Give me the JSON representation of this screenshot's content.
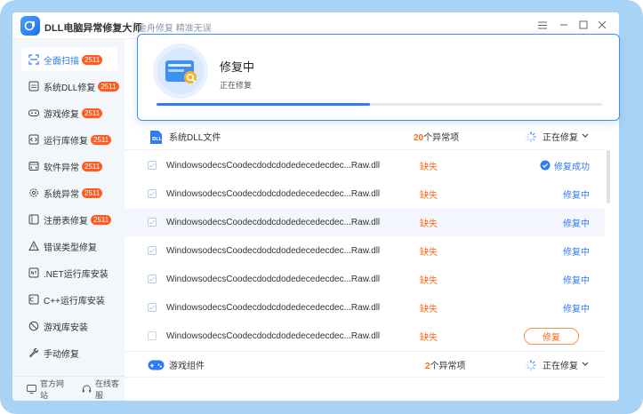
{
  "app": {
    "title": "DLL电脑异常修复大师",
    "slogan": "金舟修复 精准无误"
  },
  "window_controls": [
    "menu-icon",
    "minimize-icon",
    "maximize-icon",
    "close-icon"
  ],
  "sidebar": {
    "items": [
      {
        "label": "全面扫描",
        "badge": "2511",
        "icon": "scan-icon",
        "active": true
      },
      {
        "label": "系统DLL修复",
        "badge": "2511",
        "icon": "dll-icon"
      },
      {
        "label": "游戏修复",
        "badge": "2511",
        "icon": "gamepad-icon"
      },
      {
        "label": "运行库修复",
        "badge": "2511",
        "icon": "runtime-icon"
      },
      {
        "label": "软件异常",
        "badge": "2511",
        "icon": "software-icon"
      },
      {
        "label": "系统异常",
        "badge": "2511",
        "icon": "gear-icon"
      },
      {
        "label": "注册表修复",
        "badge": "2511",
        "icon": "registry-icon"
      },
      {
        "label": "错误类型修复",
        "badge": "",
        "icon": "warning-icon"
      },
      {
        "label": ".NET运行库安装",
        "badge": "",
        "icon": "net-icon"
      },
      {
        "label": "C++运行库安装",
        "badge": "",
        "icon": "cpp-icon"
      },
      {
        "label": "游戏库安装",
        "badge": "",
        "icon": "game-lib-icon"
      },
      {
        "label": "手动修复",
        "badge": "",
        "icon": "wrench-icon"
      }
    ],
    "footer": {
      "website": "官方网站",
      "support": "在线客服"
    }
  },
  "popup": {
    "title": "修复中",
    "subtitle": "正在修复",
    "progress": 0.48
  },
  "groups": [
    {
      "name": "系统DLL文件",
      "count": "20",
      "count_suffix": "个异常项",
      "status": "正在修复",
      "icon": "dll-file-icon"
    },
    {
      "name": "游戏组件",
      "count": "2",
      "count_suffix": "个异常项",
      "status": "正在修复",
      "icon": "gamepad-icon"
    }
  ],
  "rows": [
    {
      "file": "WindowsodecsCoodecdodcdodedecedecdec...Raw.dll",
      "status": "缺失",
      "action": "修复成功",
      "checked": true
    },
    {
      "file": "WindowsodecsCoodecdodcdodedecedecdec...Raw.dll",
      "status": "缺失",
      "action": "修复中",
      "checked": true
    },
    {
      "file": "WindowsodecsCoodecdodcdodedecedecdec...Raw.dll",
      "status": "缺失",
      "action": "修复中",
      "checked": true
    },
    {
      "file": "WindowsodecsCoodecdodcdodedecedecdec...Raw.dll",
      "status": "缺失",
      "action": "修复中",
      "checked": true
    },
    {
      "file": "WindowsodecsCoodecdodcdodedecedecdec...Raw.dll",
      "status": "缺失",
      "action": "修复中",
      "checked": true
    },
    {
      "file": "WindowsodecsCoodecdodcdodedecedecdec...Raw.dll",
      "status": "缺失",
      "action": "修复中",
      "checked": true
    },
    {
      "file": "WindowsodecsCoodecdodcdodedecedecdec...Raw.dll",
      "status": "缺失",
      "action": "修复",
      "checked": false
    }
  ],
  "colors": {
    "accent": "#2f7bf5",
    "warning": "#ff6a1a",
    "badge": "#ff5a1f",
    "frame": "#a9d3f5"
  }
}
